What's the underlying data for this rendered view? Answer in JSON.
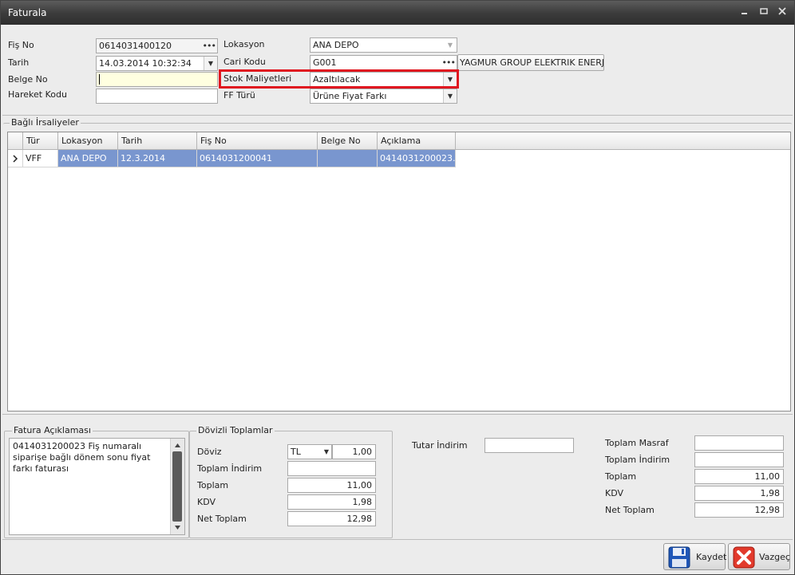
{
  "window": {
    "title": "Faturala"
  },
  "header": {
    "fis_no": {
      "label": "Fiş No",
      "value": "0614031400120"
    },
    "tarih": {
      "label": "Tarih",
      "value": "14.03.2014 10:32:34"
    },
    "belge_no": {
      "label": "Belge No",
      "value": ""
    },
    "hareket_kodu": {
      "label": "Hareket Kodu",
      "value": ""
    },
    "lokasyon": {
      "label": "Lokasyon",
      "value": "ANA DEPO"
    },
    "cari_kodu": {
      "label": "Cari Kodu",
      "value": "G001",
      "name": "YAGMUR GROUP ELEKTRIK ENERJ..."
    },
    "stok_maliyetleri": {
      "label": "Stok Maliyetleri",
      "value": "Azaltılacak"
    },
    "ff_turu": {
      "label": "FF Türü",
      "value": "Ürüne Fiyat Farkı"
    }
  },
  "linked": {
    "title": "Bağlı İrsaliyeler",
    "columns": [
      "Tür",
      "Lokasyon",
      "Tarih",
      "Fiş No",
      "Belge No",
      "Açıklama"
    ],
    "rows": [
      {
        "tur": "VFF",
        "lokasyon": "ANA DEPO",
        "tarih": "12.3.2014",
        "fis_no": "0614031200041",
        "belge_no": "",
        "aciklama": "0414031200023..."
      }
    ]
  },
  "description": {
    "title": "Fatura Açıklaması",
    "text": "0414031200023 Fiş numaralı siparişe bağlı dönem sonu fiyat farkı faturası"
  },
  "fx_totals": {
    "title": "Dövizli Toplamlar",
    "doviz_label": "Döviz",
    "doviz_value": "TL",
    "rate": "1,00",
    "toplam_indirim_label": "Toplam İndirim",
    "toplam_indirim": "",
    "toplam_label": "Toplam",
    "toplam": "11,00",
    "kdv_label": "KDV",
    "kdv": "1,98",
    "net_toplam_label": "Net Toplam",
    "net_toplam": "12,98"
  },
  "discount": {
    "label": "Tutar İndirim",
    "value": ""
  },
  "totals": {
    "toplam_masraf_label": "Toplam Masraf",
    "toplam_masraf": "",
    "toplam_indirim_label": "Toplam İndirim",
    "toplam_indirim": "",
    "toplam_label": "Toplam",
    "toplam": "11,00",
    "kdv_label": "KDV",
    "kdv": "1,98",
    "net_toplam_label": "Net Toplam",
    "net_toplam": "12,98"
  },
  "buttons": {
    "save": "Kaydet",
    "cancel": "Vazgeç"
  },
  "colors": {
    "highlight": "#e0161f",
    "selected_row": "#7996cf"
  }
}
